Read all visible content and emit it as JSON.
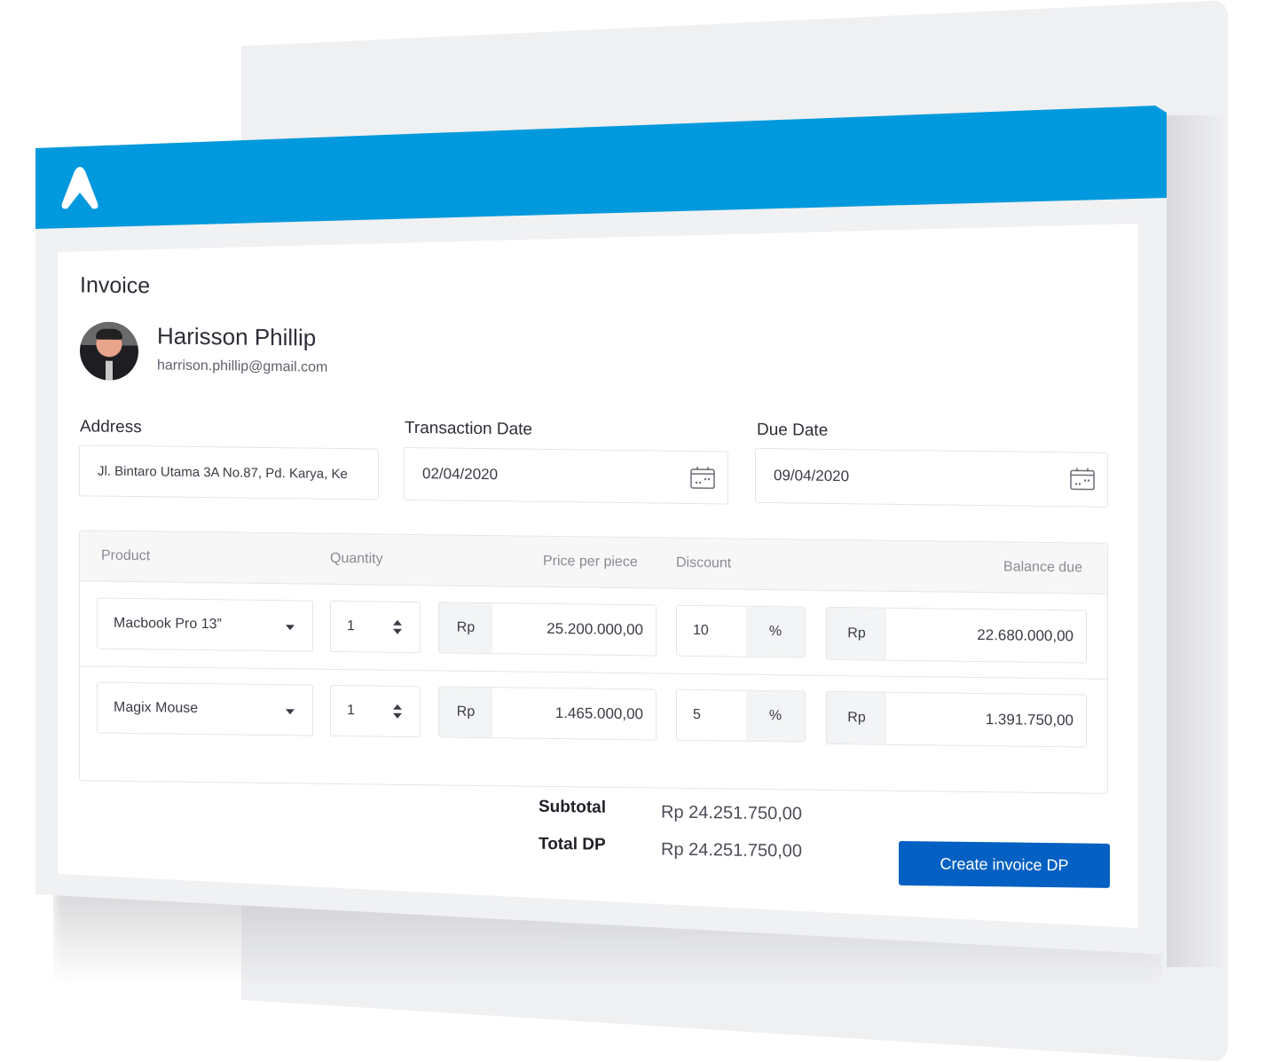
{
  "app": {
    "logo": "app-logo-icon"
  },
  "invoice": {
    "title": "Invoice",
    "customer": {
      "name": "Harisson Phillip",
      "email": "harrison.phillip@gmail.com"
    },
    "address": {
      "label": "Address",
      "value": "Jl. Bintaro Utama 3A No.87, Pd. Karya, Ke"
    },
    "transaction_date": {
      "label": "Transaction Date",
      "value": "02/04/2020",
      "icon": "calendar-icon"
    },
    "due_date": {
      "label": "Due Date",
      "value": "09/04/2020",
      "icon": "calendar-icon"
    }
  },
  "table": {
    "headers": [
      "Product",
      "Quantity",
      "Price per piece",
      "Discount",
      "Balance due"
    ],
    "rows": [
      {
        "product": "Macbook Pro 13”",
        "quantity": "1",
        "currency": "Rp",
        "price": "25.200.000,00",
        "discount": "10",
        "discount_unit": "%",
        "balance_currency": "Rp",
        "balance": "22.680.000,00"
      },
      {
        "product": "Magix Mouse",
        "quantity": "1",
        "currency": "Rp",
        "price": "1.465.000,00",
        "discount": "5",
        "discount_unit": "%",
        "balance_currency": "Rp",
        "balance": "1.391.750,00"
      }
    ]
  },
  "summary": {
    "subtotal_label": "Subtotal",
    "subtotal_value": "Rp 24.251.750,00",
    "total_dp_label": "Total DP",
    "total_dp_value": "Rp 24.251.750,00"
  },
  "actions": {
    "create_label": "Create invoice DP"
  },
  "colors": {
    "header": "#0099dd",
    "primary_button": "#0460c2"
  }
}
